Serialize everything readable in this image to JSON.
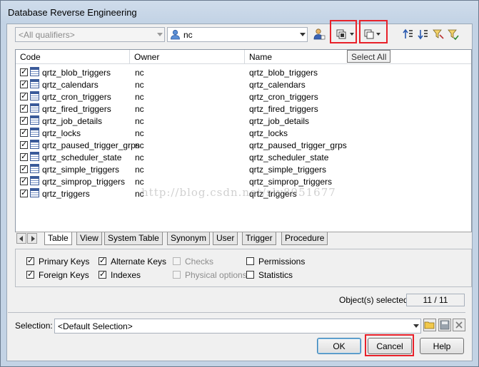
{
  "window": {
    "title": "Database Reverse Engineering"
  },
  "toolbar": {
    "qualifier_placeholder": "<All qualifiers>",
    "owner_value": "nc",
    "tooltip": "Select All"
  },
  "table": {
    "headers": [
      "Code",
      "Owner",
      "Name"
    ],
    "rows": [
      {
        "code": "qrtz_blob_triggers",
        "owner": "nc",
        "name": "qrtz_blob_triggers"
      },
      {
        "code": "qrtz_calendars",
        "owner": "nc",
        "name": "qrtz_calendars"
      },
      {
        "code": "qrtz_cron_triggers",
        "owner": "nc",
        "name": "qrtz_cron_triggers"
      },
      {
        "code": "qrtz_fired_triggers",
        "owner": "nc",
        "name": "qrtz_fired_triggers"
      },
      {
        "code": "qrtz_job_details",
        "owner": "nc",
        "name": "qrtz_job_details"
      },
      {
        "code": "qrtz_locks",
        "owner": "nc",
        "name": "qrtz_locks"
      },
      {
        "code": "qrtz_paused_trigger_grps",
        "owner": "nc",
        "name": "qrtz_paused_trigger_grps"
      },
      {
        "code": "qrtz_scheduler_state",
        "owner": "nc",
        "name": "qrtz_scheduler_state"
      },
      {
        "code": "qrtz_simple_triggers",
        "owner": "nc",
        "name": "qrtz_simple_triggers"
      },
      {
        "code": "qrtz_simprop_triggers",
        "owner": "nc",
        "name": "qrtz_simprop_triggers"
      },
      {
        "code": "qrtz_triggers",
        "owner": "nc",
        "name": "qrtz_triggers"
      }
    ]
  },
  "watermark": "http://blog.csdn.net/sly8951677",
  "tabs": [
    "Table",
    "View",
    "System Table",
    "Synonym",
    "User",
    "Trigger",
    "Procedure"
  ],
  "options": {
    "primary_keys": "Primary Keys",
    "foreign_keys": "Foreign Keys",
    "alternate_keys": "Alternate Keys",
    "indexes": "Indexes",
    "checks": "Checks",
    "physical_options": "Physical options",
    "permissions": "Permissions",
    "statistics": "Statistics"
  },
  "status": {
    "label": "Object(s) selected:",
    "value": "11 / 11"
  },
  "selection": {
    "label": "Selection:",
    "value": "<Default Selection>"
  },
  "buttons": {
    "ok": "OK",
    "cancel": "Cancel",
    "help": "Help"
  }
}
